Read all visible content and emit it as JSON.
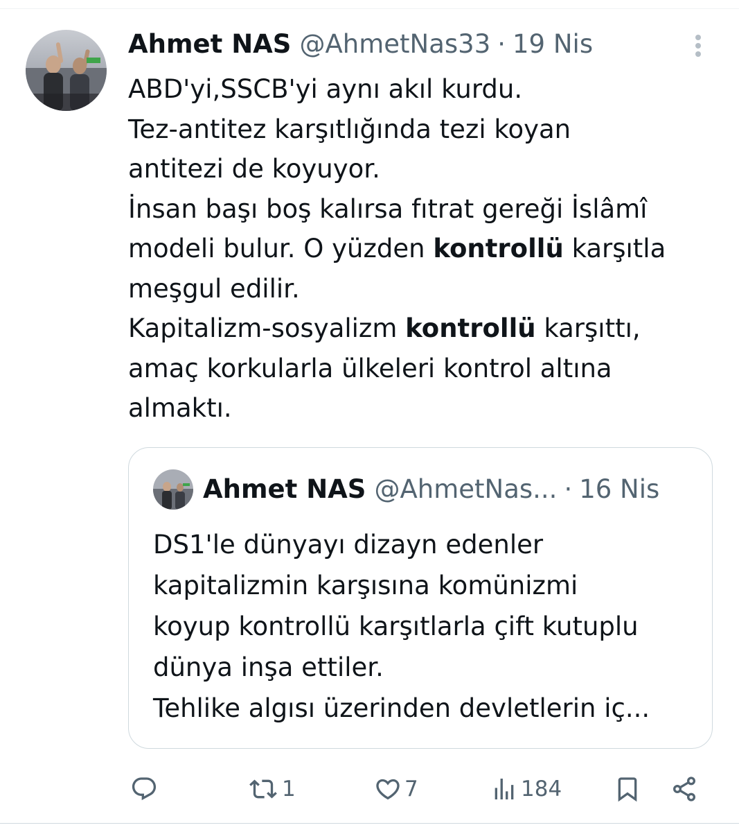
{
  "tweet": {
    "author_name": "Ahmet NAS",
    "handle": "@AhmetNas33",
    "separator": "·",
    "date": "19 Nis",
    "text_lines": [
      [
        {
          "t": "ABD'yi,SSCB'yi aynı akıl kurdu."
        }
      ],
      [
        {
          "t": "Tez-antitez karşıtlığında tezi koyan"
        }
      ],
      [
        {
          "t": "antitezi de koyuyor."
        }
      ],
      [
        {
          "t": "İnsan başı boş kalırsa fıtrat gereği İslâmî"
        }
      ],
      [
        {
          "t": "modeli bulur. O yüzden "
        },
        {
          "t": "kontrollü",
          "b": true
        },
        {
          "t": " karşıtla"
        }
      ],
      [
        {
          "t": "meşgul edilir."
        }
      ],
      [
        {
          "t": "Kapitalizm-sosyalizm "
        },
        {
          "t": "kontrollü",
          "b": true
        },
        {
          "t": " karşıttı,"
        }
      ],
      [
        {
          "t": "amaç korkularla ülkeleri kontrol altına"
        }
      ],
      [
        {
          "t": "almaktı."
        }
      ]
    ]
  },
  "quoted": {
    "author_name": "Ahmet NAS",
    "handle": "@AhmetNas...",
    "separator": "·",
    "date": "16 Nis",
    "text_lines": [
      "DS1'le dünyayı dizayn edenler",
      "kapitalizmin karşısına komünizmi",
      "koyup kontrollü karşıtlarla çift kutuplu",
      "dünya inşa ettiler.",
      "Tehlike algısı üzerinden devletlerin iç..."
    ]
  },
  "actions": {
    "reply_count": "",
    "retweet_count": "1",
    "like_count": "7",
    "views_count": "184"
  },
  "icons": {
    "more": "more-vertical-icon",
    "reply": "reply-icon",
    "retweet": "retweet-icon",
    "like": "heart-icon",
    "views": "views-icon",
    "bookmark": "bookmark-icon",
    "share": "share-icon"
  },
  "colors": {
    "text_primary": "#0f1419",
    "text_secondary": "#536471",
    "border": "#cfd9de"
  }
}
